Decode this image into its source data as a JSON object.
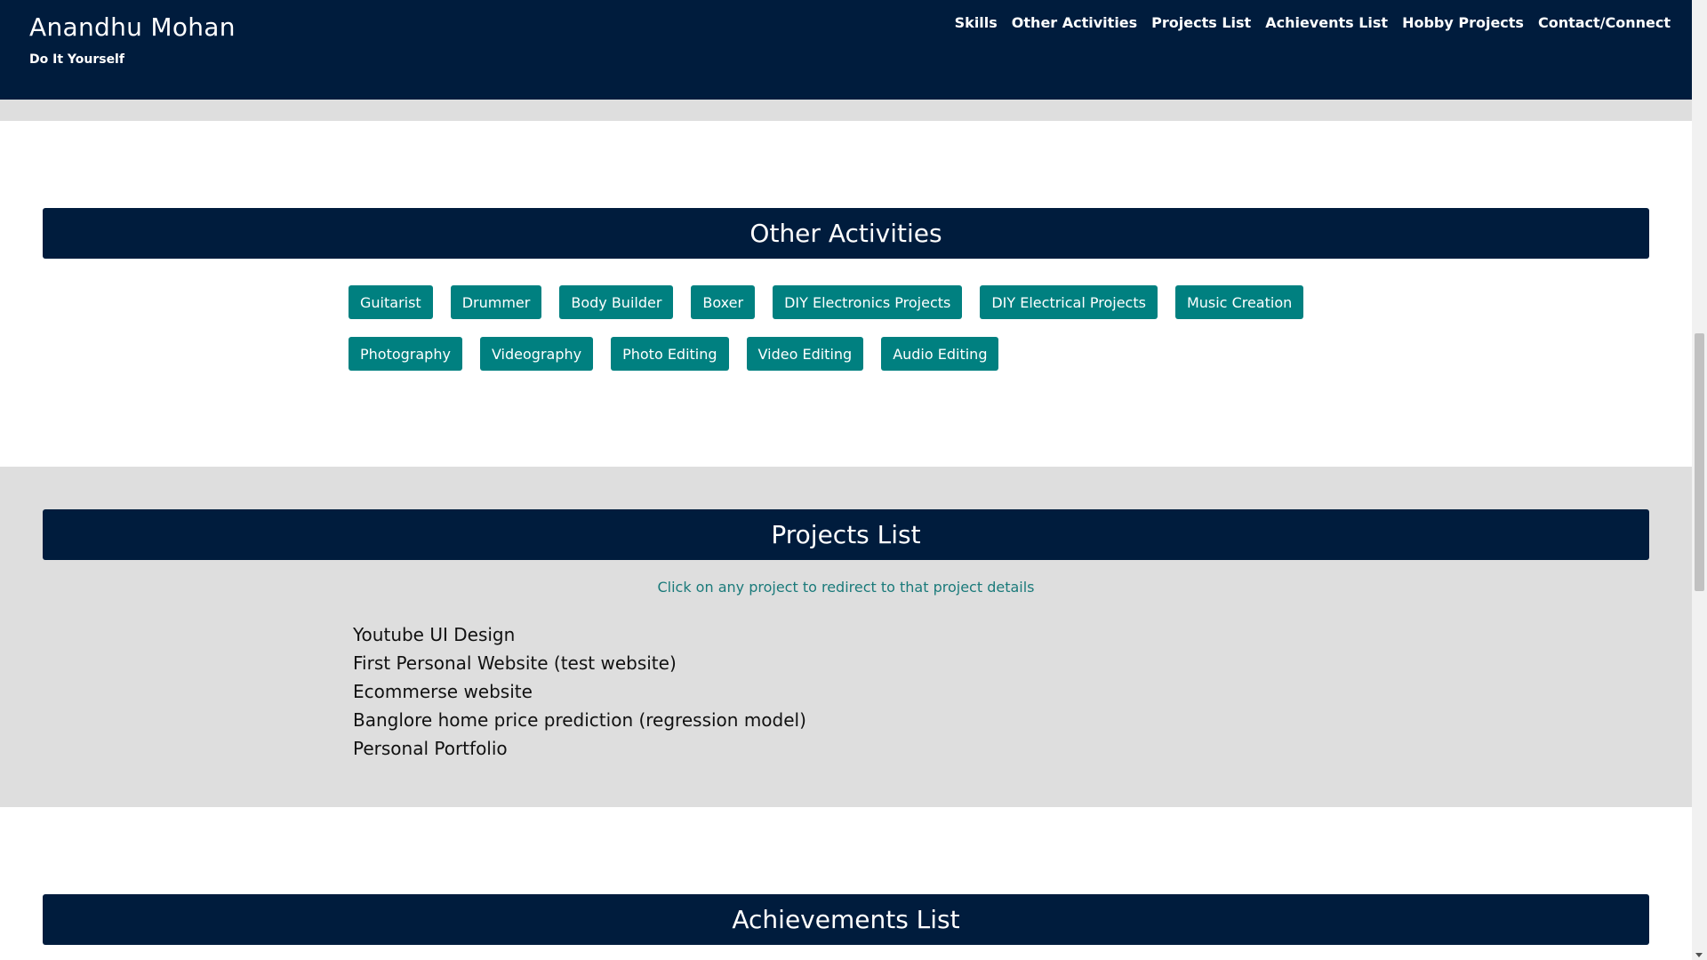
{
  "header": {
    "name": "Anandhu Mohan",
    "tagline": "Do It Yourself",
    "nav": [
      {
        "label": "Skills"
      },
      {
        "label": "Other Activities"
      },
      {
        "label": "Projects List"
      },
      {
        "label": "Achievents List"
      },
      {
        "label": "Hobby Projects"
      },
      {
        "label": "Contact/Connect"
      }
    ]
  },
  "activities": {
    "title": "Other Activities",
    "row1": [
      {
        "label": "Guitarist"
      },
      {
        "label": "Drummer"
      },
      {
        "label": "Body Builder"
      },
      {
        "label": "Boxer"
      },
      {
        "label": "DIY Electronics Projects"
      },
      {
        "label": "DIY Electrical Projects"
      },
      {
        "label": "Music Creation"
      }
    ],
    "row2": [
      {
        "label": "Photography"
      },
      {
        "label": "Videography"
      },
      {
        "label": "Photo Editing"
      },
      {
        "label": "Video Editing"
      },
      {
        "label": "Audio Editing"
      }
    ]
  },
  "projects": {
    "title": "Projects List",
    "hint": "Click on any project to redirect to that project details",
    "items": [
      {
        "label": "Youtube UI Design"
      },
      {
        "label": "First Personal Website (test website)"
      },
      {
        "label": "Ecommerse website"
      },
      {
        "label": "Banglore home price prediction (regression model)"
      },
      {
        "label": "Personal Portfolio"
      }
    ]
  },
  "achievements": {
    "title": "Achievements List"
  },
  "colors": {
    "navy": "#001c3d",
    "teal": "#008080",
    "grey_section": "#dedede"
  }
}
